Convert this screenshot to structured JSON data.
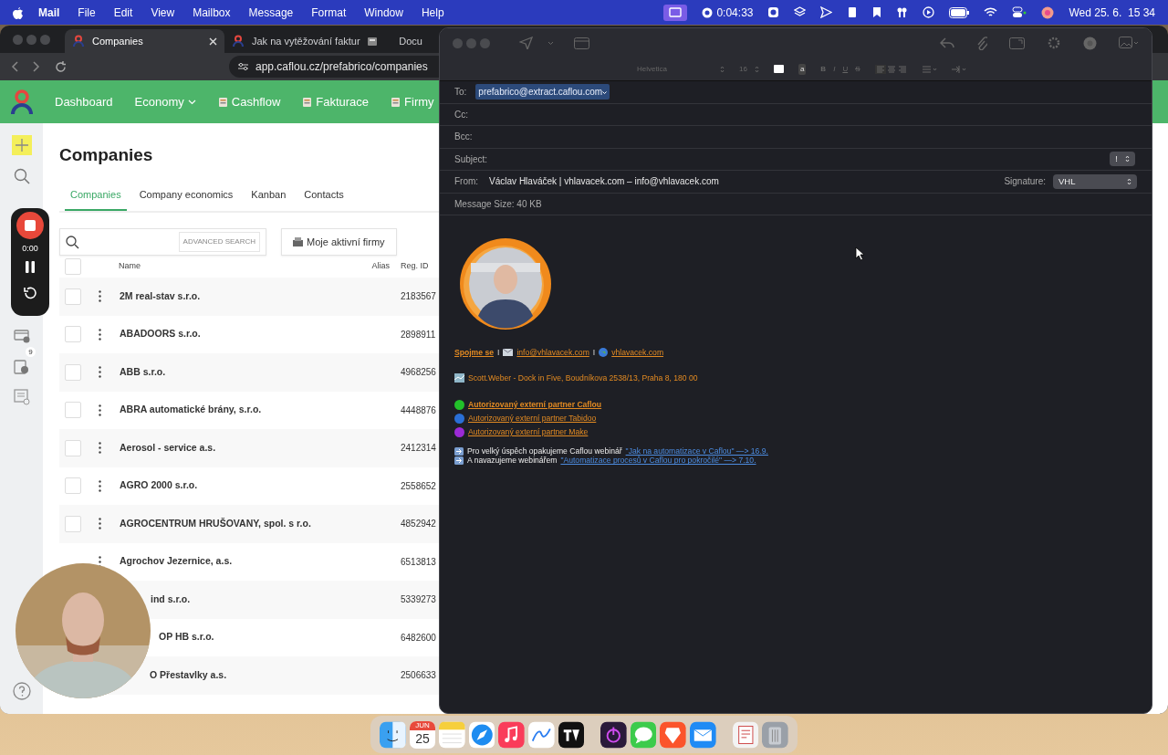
{
  "menu_bar": {
    "app": "Mail",
    "menus": [
      "File",
      "Edit",
      "View",
      "Mailbox",
      "Message",
      "Format",
      "Window",
      "Help"
    ],
    "timer": "0:04:33",
    "clock": "Wed 25. 6.  15 34"
  },
  "browser": {
    "tabs": [
      {
        "title": "Companies",
        "selected": true
      },
      {
        "title": "Jak na vytěžování faktur",
        "selected": false
      },
      {
        "title": "Docu",
        "selected": false
      }
    ],
    "url": "app.caflou.cz/prefabrico/companies"
  },
  "app_nav": [
    {
      "label": "Dashboard",
      "kind": "link"
    },
    {
      "label": "Economy",
      "kind": "dropdown"
    },
    {
      "label": "Cashflow",
      "kind": "icon_link"
    },
    {
      "label": "Fakturace",
      "kind": "icon_link"
    },
    {
      "label": "Firmy",
      "kind": "icon_link"
    }
  ],
  "sidebar": {
    "badge": "9"
  },
  "recorder": {
    "time": "0:00"
  },
  "page": {
    "title": "Companies",
    "tabs": [
      {
        "label": "Companies",
        "selected": true
      },
      {
        "label": "Company economics",
        "selected": false
      },
      {
        "label": "Kanban",
        "selected": false
      },
      {
        "label": "Contacts",
        "selected": false
      }
    ],
    "search": {
      "button": "ADVANCED SEARCH"
    },
    "filter_button": "Moje aktivní firmy",
    "table": {
      "columns": [
        "Name",
        "Alias",
        "Reg. ID"
      ],
      "all_checked": false,
      "rows": [
        {
          "name": "2M real-stav s.r.o.",
          "reg_id": "2183567",
          "checked": false
        },
        {
          "name": "ABADOORS s.r.o.",
          "reg_id": "2898911",
          "checked": false
        },
        {
          "name": "ABB s.r.o.",
          "reg_id": "4968256",
          "checked": false
        },
        {
          "name": "ABRA automatické brány, s.r.o.",
          "reg_id": "4448876",
          "checked": false
        },
        {
          "name": "Aerosol - service a.s.",
          "reg_id": "2412314",
          "checked": false
        },
        {
          "name": "AGRO 2000 s.r.o.",
          "reg_id": "2558652",
          "checked": false
        },
        {
          "name": "AGROCENTRUM HRUŠOVANY, spol. s r.o.",
          "reg_id": "4852942",
          "checked": false
        },
        {
          "name": "Agrochov Jezernice, a.s.",
          "reg_id": "6513813"
        },
        {
          "name": "ind s.r.o.",
          "reg_id": "5339273"
        },
        {
          "name": "OP HB s.r.o.",
          "reg_id": "6482600"
        },
        {
          "name": "O Přestavlky a.s.",
          "reg_id": "2506633"
        }
      ]
    }
  },
  "mail": {
    "format": {
      "font": "Helvetica",
      "size": "16",
      "styles": [
        "B",
        "I",
        "U",
        "S"
      ],
      "highlight": "a"
    },
    "fields": {
      "to_label": "To:",
      "to": "prefabrico@extract.caflou.com",
      "cc_label": "Cc:",
      "bcc_label": "Bcc:",
      "subject_label": "Subject:",
      "priority": "!",
      "from_label": "From:",
      "from": "Václav Hlaváček | vhlavacek.com – info@vhlavacek.com",
      "signature_label": "Signature:",
      "signature": "VHL",
      "size": "Message Size: 40 KB"
    },
    "signature": {
      "contact": {
        "title": "Spojme se",
        "sep1": "I",
        "email": "info@vhlavacek.com",
        "sep2": "I",
        "web": "vhlavacek.com"
      },
      "address": "Scott.Weber - Dock in Five, Boudníkova 2538/13, Praha 8, 180 00",
      "partners": [
        {
          "text": "Autorizovaný externí partner Caflou",
          "color": "#22c02a",
          "bold": true
        },
        {
          "text": "Autorizovaný externí partner Tabidoo",
          "color": "#2a6fd6",
          "bold": false
        },
        {
          "text": "Autorizovaný externí partner Make",
          "color": "#9b2ad6",
          "bold": false
        }
      ],
      "webinars": [
        {
          "text": "Pro velký úspěch opakujeme Caflou webinář",
          "link": "\"Jak na automatizace v Caflou\" —> 16.9."
        },
        {
          "text": "A navazujeme webinářem",
          "link": "\"Automatizace procesů v Caflou pro pokročilé\" —> 7.10."
        }
      ]
    }
  },
  "dock": {
    "month": "JUN",
    "day": "25"
  }
}
